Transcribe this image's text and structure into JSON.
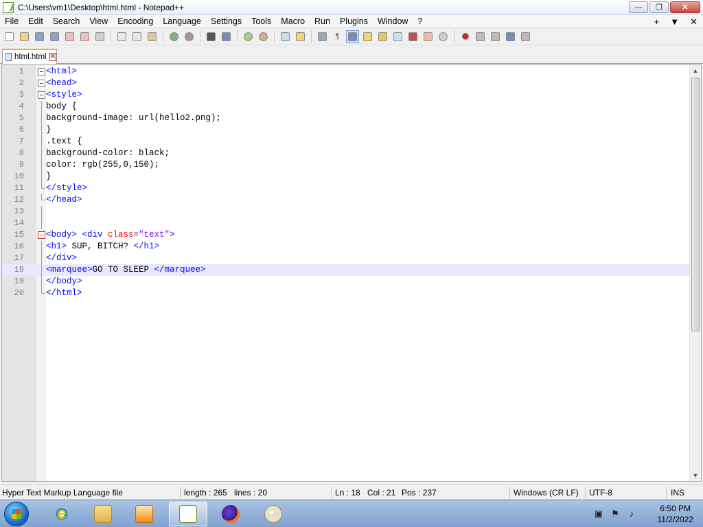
{
  "window": {
    "title": "C:\\Users\\vm1\\Desktop\\html.html - Notepad++",
    "minimize_glyph": "—",
    "restore_glyph": "❐",
    "close_glyph": "✕"
  },
  "menu": {
    "items": [
      "File",
      "Edit",
      "Search",
      "View",
      "Encoding",
      "Language",
      "Settings",
      "Tools",
      "Macro",
      "Run",
      "Plugins",
      "Window",
      "?"
    ],
    "right": [
      "+",
      "▼",
      "✕"
    ]
  },
  "tab": {
    "label": "html.html",
    "close_glyph": "✕"
  },
  "editor": {
    "lines": [
      {
        "n": "1"
      },
      {
        "n": "2"
      },
      {
        "n": "3"
      },
      {
        "n": "4"
      },
      {
        "n": "5"
      },
      {
        "n": "6"
      },
      {
        "n": "7"
      },
      {
        "n": "8"
      },
      {
        "n": "9"
      },
      {
        "n": "10"
      },
      {
        "n": "11"
      },
      {
        "n": "12"
      },
      {
        "n": "13"
      },
      {
        "n": "14"
      },
      {
        "n": "15"
      },
      {
        "n": "16"
      },
      {
        "n": "17"
      },
      {
        "n": "18"
      },
      {
        "n": "19"
      },
      {
        "n": "20"
      }
    ],
    "code": {
      "l1": "<html>",
      "l2": "<head>",
      "l3": "<style>",
      "l4": "body {",
      "l5": "background-image: url(hello2.png);",
      "l6": "}",
      "l7": ".text {",
      "l8": "background-color: black;",
      "l9": "color: rgb(255,0,150);",
      "l10": "}",
      "l11": "</style>",
      "l12": "</head>",
      "l15_a": "<body> <div ",
      "l15_b": "class",
      "l15_c": "=",
      "l15_d": "\"text\"",
      "l15_e": ">",
      "l16_a": "<h1>",
      "l16_b": " SUP, BITCH? ",
      "l16_c": "</h1>",
      "l17": "</div>",
      "l18_a": "<marquee>",
      "l18_b": "GO TO SLEEP ",
      "l18_c": "</marquee>",
      "l19": "</body>",
      "l20": "</html>"
    }
  },
  "status": {
    "file_type": "Hyper Text Markup Language file",
    "length": "length : 265",
    "lines": "lines : 20",
    "ln": "Ln : 18",
    "col": "Col : 21",
    "pos": "Pos : 237",
    "eol": "Windows (CR LF)",
    "encoding": "UTF-8",
    "mode": "INS"
  },
  "taskbar": {
    "time": "6:50 PM",
    "date": "11/2/2022",
    "ie_glyph": "e"
  }
}
